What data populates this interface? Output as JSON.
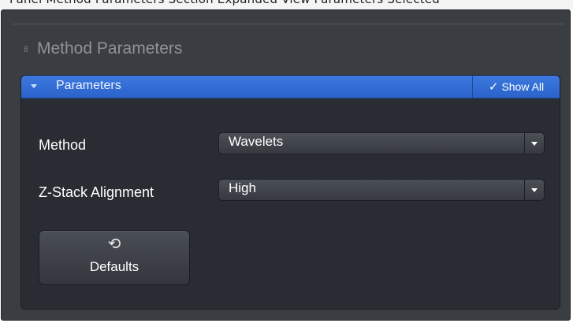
{
  "top_strip": {
    "cut_text": "Panel Method Parameters Section Expanded View Parameters Selected"
  },
  "section": {
    "title": "Method Parameters",
    "grip_icon": "grip-dots-icon"
  },
  "group": {
    "title": "Parameters",
    "collapse_icon": "chevron-down-icon",
    "show_all": {
      "label": "Show All",
      "icon": "checkmark-icon"
    }
  },
  "fields": {
    "method": {
      "label": "Method",
      "value": "Wavelets",
      "icon": "dropdown-arrow-icon"
    },
    "zstack": {
      "label": "Z-Stack Alignment",
      "value": "High",
      "icon": "dropdown-arrow-icon"
    }
  },
  "defaults_button": {
    "label": "Defaults",
    "icon": "reset-icon"
  },
  "colors": {
    "panel_bg": "#3a3d42",
    "group_bg": "#292c32",
    "header_accent": "#2f6fd6",
    "muted_title": "#8f9399"
  }
}
